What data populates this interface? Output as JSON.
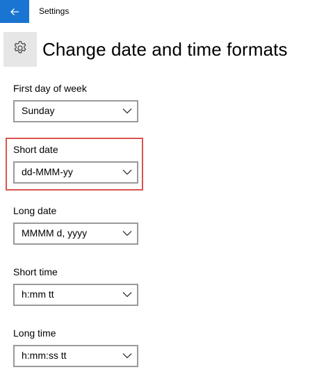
{
  "window": {
    "app_title": "Settings",
    "accent_color": "#1a74d1"
  },
  "header": {
    "title": "Change date and time formats",
    "icon": "gear-icon"
  },
  "settings": {
    "first_day_of_week": {
      "label": "First day of week",
      "value": "Sunday"
    },
    "short_date": {
      "label": "Short date",
      "value": "dd-MMM-yy"
    },
    "long_date": {
      "label": "Long date",
      "value": "MMMM d, yyyy"
    },
    "short_time": {
      "label": "Short time",
      "value": "h:mm tt"
    },
    "long_time": {
      "label": "Long time",
      "value": "h:mm:ss tt"
    }
  },
  "highlight": {
    "target": "short_date",
    "color": "#d9534f"
  }
}
